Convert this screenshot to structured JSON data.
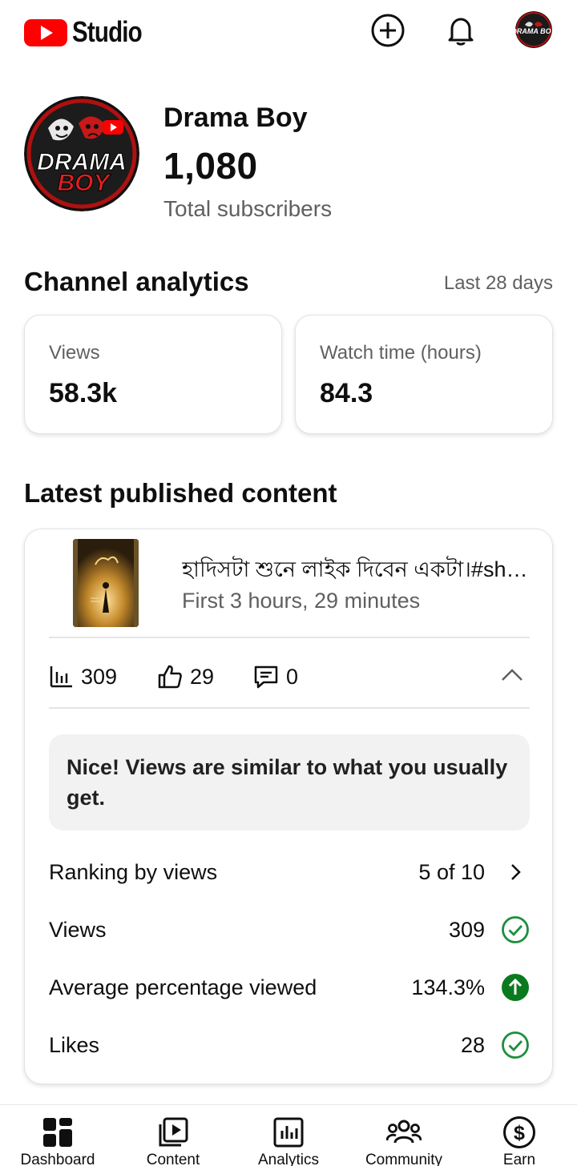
{
  "app": {
    "logo_text": "Studio"
  },
  "topbar": {
    "create_icon": "add-circle-icon",
    "notifications_icon": "bell-icon",
    "avatar_label": "DRAMA BOY"
  },
  "channel": {
    "name": "Drama Boy",
    "subscribers": "1,080",
    "subscribers_label": "Total subscribers",
    "avatar_line1": "DRAMA",
    "avatar_line2": "BOY"
  },
  "analytics": {
    "title": "Channel analytics",
    "range": "Last 28 days",
    "cards": [
      {
        "label": "Views",
        "value": "58.3k"
      },
      {
        "label": "Watch time (hours)",
        "value": "84.3"
      }
    ]
  },
  "latest": {
    "title": "Latest published content",
    "video": {
      "title": "হাদিসটা শুনে লাইক দিবেন একটা।#shorts",
      "period": "First 3 hours, 29 minutes",
      "views": "309",
      "likes": "29",
      "comments": "0"
    },
    "insight": "Nice! Views are similar to what you usually get.",
    "rows": [
      {
        "label": "Ranking by views",
        "value": "5 of 10",
        "icon": "chevron-right-icon"
      },
      {
        "label": "Views",
        "value": "309",
        "icon": "check-circle-icon"
      },
      {
        "label": "Average percentage viewed",
        "value": "134.3%",
        "icon": "arrow-up-circle-icon"
      },
      {
        "label": "Likes",
        "value": "28",
        "icon": "check-circle-icon"
      }
    ]
  },
  "nav": [
    {
      "label": "Dashboard",
      "icon": "dashboard-icon",
      "active": true
    },
    {
      "label": "Content",
      "icon": "content-icon"
    },
    {
      "label": "Analytics",
      "icon": "analytics-icon"
    },
    {
      "label": "Community",
      "icon": "community-icon"
    },
    {
      "label": "Earn",
      "icon": "earn-icon"
    }
  ],
  "colors": {
    "brand_red": "#ff0000",
    "success_green": "#1e8e3e",
    "up_green": "#0b7a1f",
    "text_secondary": "#606060"
  }
}
